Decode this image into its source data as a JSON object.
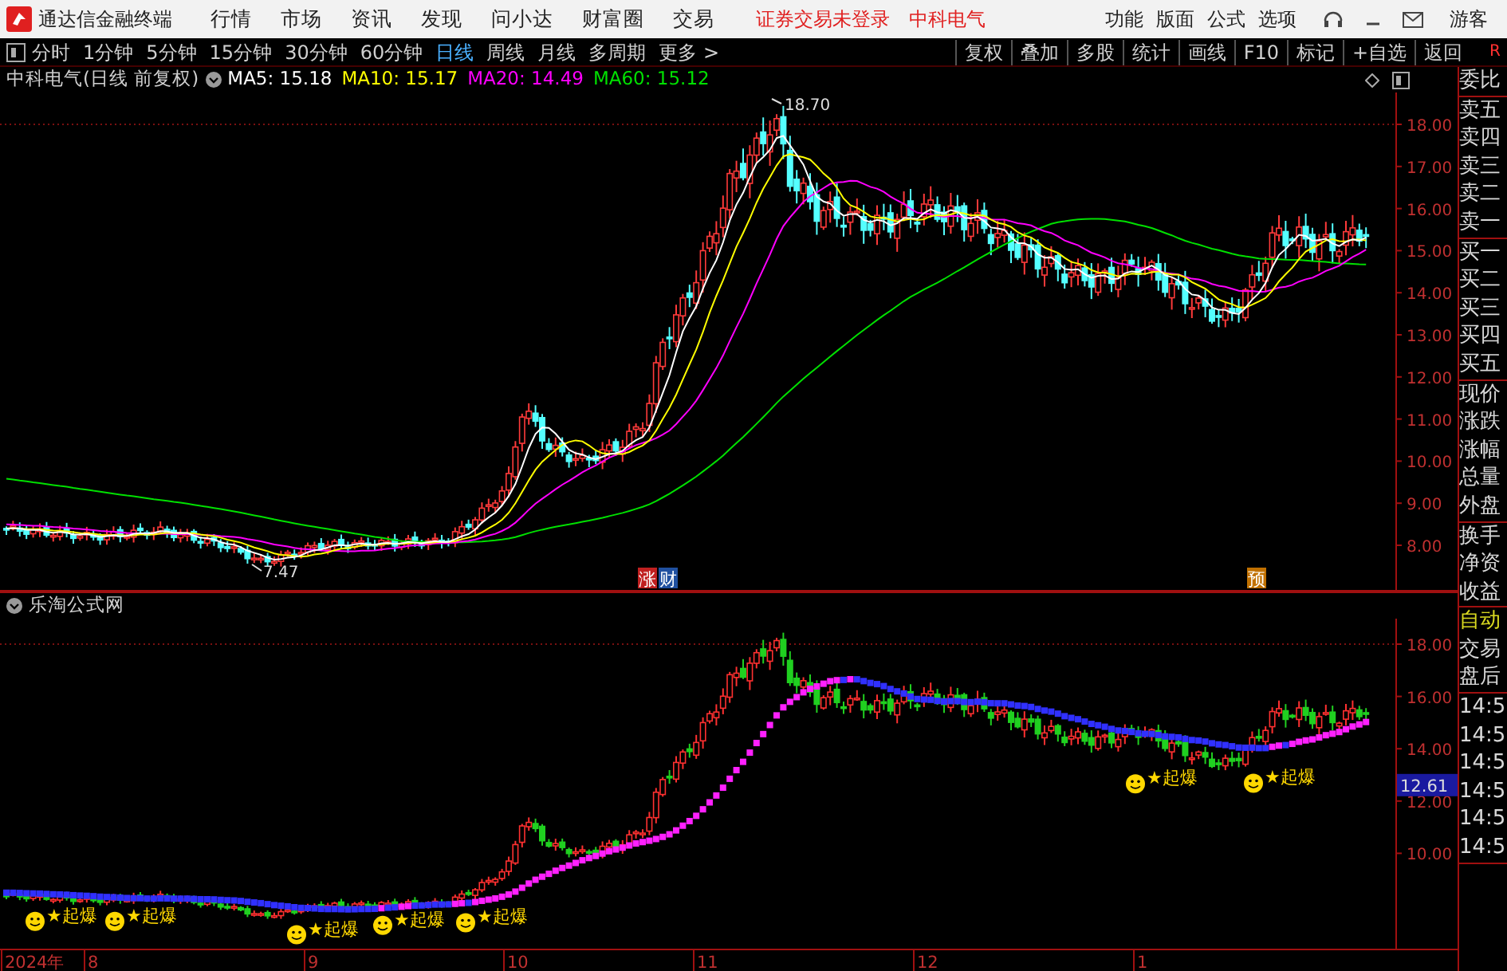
{
  "title_bar": {
    "app_name": "通达信金融终端",
    "menu": [
      "行情",
      "市场",
      "资讯",
      "发现",
      "问小达",
      "财富圈",
      "交易"
    ],
    "notice": "证券交易未登录",
    "stock_name": "中科电气",
    "right_menu": [
      "功能",
      "版面",
      "公式",
      "选项"
    ],
    "user": "游客"
  },
  "toolbar": {
    "periods": [
      {
        "label": "分时",
        "selected": false
      },
      {
        "label": "1分钟",
        "selected": false
      },
      {
        "label": "5分钟",
        "selected": false
      },
      {
        "label": "15分钟",
        "selected": false
      },
      {
        "label": "30分钟",
        "selected": false
      },
      {
        "label": "60分钟",
        "selected": false
      },
      {
        "label": "日线",
        "selected": true
      },
      {
        "label": "周线",
        "selected": false
      },
      {
        "label": "月线",
        "selected": false
      },
      {
        "label": "多周期",
        "selected": false
      },
      {
        "label": "更多 >",
        "selected": false
      }
    ],
    "buttons": [
      "复权",
      "叠加",
      "多股",
      "统计",
      "画线",
      "F10",
      "标记",
      "+自选",
      "返回"
    ],
    "corner": "R"
  },
  "info_line": {
    "title": "中科电气(日线 前复权)",
    "averages": [
      {
        "label": "MA5: 15.18",
        "color": "#ffffff"
      },
      {
        "label": "MA10: 15.17",
        "color": "#ffff00"
      },
      {
        "label": "MA20: 14.49",
        "color": "#ff00ff"
      },
      {
        "label": "MA60: 15.12",
        "color": "#00e000"
      }
    ]
  },
  "main_chart": {
    "price_axis": [
      "18.00",
      "17.00",
      "16.00",
      "15.00",
      "14.00",
      "13.00",
      "12.00",
      "11.00",
      "10.00",
      "9.00",
      "8.00"
    ],
    "high_label": "18.70",
    "low_label": "7.47",
    "markers": [
      {
        "text": "涨",
        "color": "#c02020"
      },
      {
        "text": "财",
        "color": "#2050a0"
      },
      {
        "text": "预",
        "color": "#c07000"
      }
    ]
  },
  "indicator": {
    "title": "乐淘公式网",
    "price_axis": [
      "18.00",
      "16.00",
      "14.00",
      "12.00",
      "10.00"
    ],
    "current": "12.61",
    "signals": [
      "★起爆",
      "★起爆",
      "★起爆",
      "★起爆",
      "★起爆",
      "★起爆",
      "★起爆"
    ]
  },
  "x_axis": [
    "2024年",
    "8",
    "9",
    "10",
    "11",
    "12",
    "1"
  ],
  "right_panel": {
    "sections": [
      {
        "items": [
          {
            "label": "委比",
            "highlighted": false
          }
        ]
      },
      {
        "items": [
          {
            "label": "卖五",
            "highlighted": false
          },
          {
            "label": "卖四",
            "highlighted": false
          },
          {
            "label": "卖三",
            "highlighted": false
          },
          {
            "label": "卖二",
            "highlighted": false
          },
          {
            "label": "卖一",
            "highlighted": false
          }
        ]
      },
      {
        "items": [
          {
            "label": "买一",
            "highlighted": false
          },
          {
            "label": "买二",
            "highlighted": false
          },
          {
            "label": "买三",
            "highlighted": false
          },
          {
            "label": "买四",
            "highlighted": false
          },
          {
            "label": "买五",
            "highlighted": false
          }
        ]
      },
      {
        "items": [
          {
            "label": "现价",
            "highlighted": false
          },
          {
            "label": "涨跌",
            "highlighted": false
          },
          {
            "label": "涨幅",
            "highlighted": false
          },
          {
            "label": "总量",
            "highlighted": false
          },
          {
            "label": "外盘",
            "highlighted": false
          }
        ]
      },
      {
        "items": [
          {
            "label": "换手",
            "highlighted": false
          },
          {
            "label": "净资",
            "highlighted": false
          },
          {
            "label": "收益",
            "highlighted": false
          }
        ]
      },
      {
        "items": [
          {
            "label": "自动",
            "highlighted": true
          },
          {
            "label": "交易",
            "highlighted": false
          },
          {
            "label": "盘后",
            "highlighted": false
          }
        ]
      },
      {
        "items": [
          {
            "label": "14:5",
            "highlighted": false
          },
          {
            "label": "14:5",
            "highlighted": false
          },
          {
            "label": "14:5",
            "highlighted": false
          },
          {
            "label": "14:5",
            "highlighted": false
          },
          {
            "label": "14:5",
            "highlighted": false
          },
          {
            "label": "14:5",
            "highlighted": false
          }
        ]
      }
    ]
  }
}
